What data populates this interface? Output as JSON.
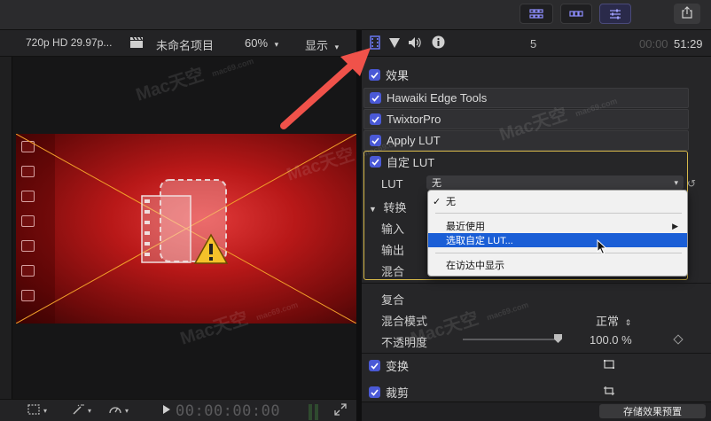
{
  "viewer": {
    "format": "720p HD 29.97p...",
    "project_name": "未命名项目",
    "zoom": "60%",
    "display_label": "显示",
    "timecode": "00:00:00:00"
  },
  "inspector": {
    "header_number": "5",
    "duration_dim": "00:00",
    "duration_main": "51:29",
    "effects_label": "效果",
    "effects": [
      {
        "label": "Hawaiki Edge Tools"
      },
      {
        "label": "TwixtorPro"
      },
      {
        "label": "Apply LUT"
      },
      {
        "label": "自定 LUT"
      }
    ],
    "lut_param_label": "LUT",
    "lut_value": "无",
    "transform_group_label": "转换",
    "input_label": "输入",
    "output_label": "输出",
    "mix_label": "混合",
    "composite_label": "复合",
    "blend_mode_label": "混合模式",
    "blend_mode_value": "正常",
    "opacity_label": "不透明度",
    "opacity_value": "100.0 %",
    "opacity_percent": 100,
    "transform_label": "变换",
    "crop_label": "裁剪",
    "save_preset_label": "存储效果预置"
  },
  "lut_menu": {
    "items": [
      {
        "label": "无",
        "checked": true
      },
      {
        "label": "最近使用",
        "submenu": true
      },
      {
        "label": "选取自定 LUT...",
        "selected": true
      },
      {
        "label": "在访达中显示"
      }
    ]
  },
  "watermark": {
    "text": "Mac天空",
    "sub": "mac69.com"
  },
  "colors": {
    "accent": "#4a59d6",
    "highlight": "#1a5ed6",
    "annotation_arrow": "#f0524a",
    "lut_box_border": "#d6b84a"
  }
}
